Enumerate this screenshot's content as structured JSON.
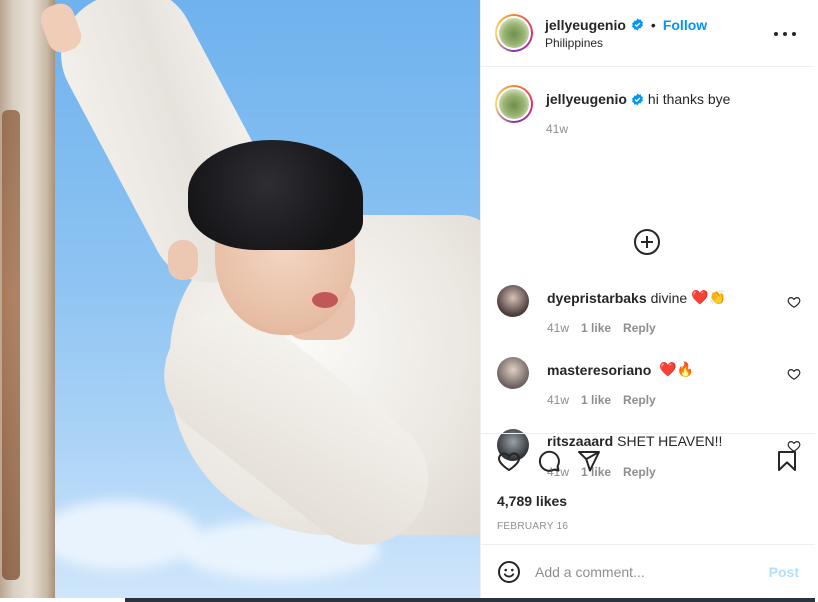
{
  "post": {
    "author": "jellyeugenio",
    "location": "Philippines",
    "follow_label": "Follow",
    "separator": "•"
  },
  "caption": {
    "username": "jellyeugenio",
    "text": "hi thanks bye",
    "time": "41w"
  },
  "comments": [
    {
      "username": "dyepristarbaks",
      "text": "divine",
      "emoji": "❤️👏",
      "time": "41w",
      "likes": "1 like",
      "reply_label": "Reply"
    },
    {
      "username": "masteresoriano",
      "text": "",
      "emoji": "❤️🔥",
      "time": "41w",
      "likes": "1 like",
      "reply_label": "Reply"
    },
    {
      "username": "ritszaaard",
      "text": "SHET HEAVEN!!",
      "emoji": "",
      "time": "41w",
      "likes": "1 like",
      "reply_label": "Reply"
    }
  ],
  "stats": {
    "likes": "4,789 likes",
    "date": "FEBRUARY 16"
  },
  "add_comment": {
    "placeholder": "Add a comment...",
    "post_label": "Post"
  },
  "icons": [
    "verified-badge-icon",
    "more-options-icon",
    "load-more-comments-icon",
    "heart-icon",
    "comment-icon",
    "share-icon",
    "bookmark-icon",
    "emoji-icon"
  ],
  "colors": {
    "accent": "#0095f6",
    "muted": "#8e8e8e",
    "text": "#262626",
    "post_disabled": "#b2dffc"
  }
}
